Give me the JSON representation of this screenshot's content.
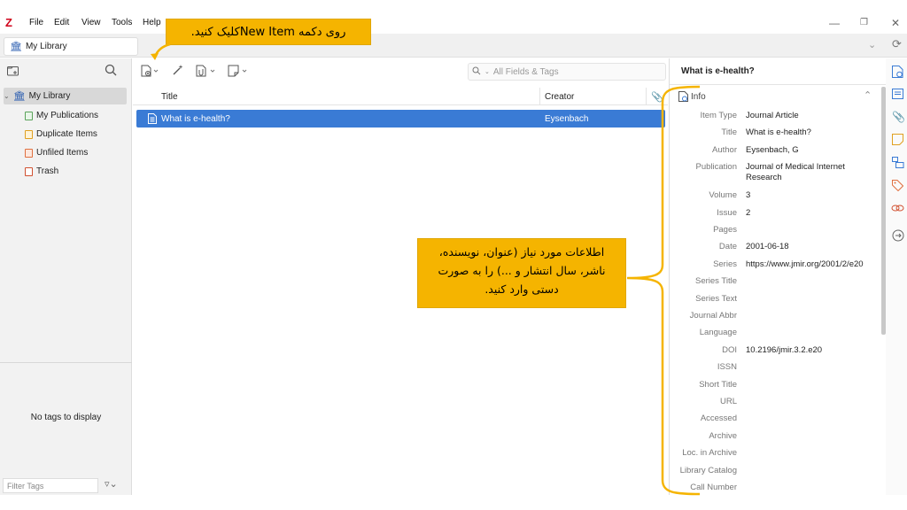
{
  "menu": {
    "logo": "Z",
    "items": [
      "File",
      "Edit",
      "View",
      "Tools",
      "Help"
    ]
  },
  "tab": {
    "label": "My Library"
  },
  "collections": {
    "root": "My Library",
    "children": [
      {
        "label": "My Publications",
        "icon": "my-publications-icon"
      },
      {
        "label": "Duplicate Items",
        "icon": "duplicate-items-icon"
      },
      {
        "label": "Unfiled Items",
        "icon": "unfiled-items-icon"
      },
      {
        "label": "Trash",
        "icon": "trash-icon"
      }
    ]
  },
  "tags": {
    "empty_text": "No tags to display",
    "filter_placeholder": "Filter Tags"
  },
  "search": {
    "placeholder": "All Fields & Tags"
  },
  "columns": {
    "title": "Title",
    "creator": "Creator"
  },
  "items": [
    {
      "title": "What is e-health?",
      "creator": "Eysenbach",
      "selected": true
    }
  ],
  "item_pane": {
    "title": "What is e-health?",
    "section": "Info",
    "fields": [
      {
        "label": "Item Type",
        "value": "Journal Article"
      },
      {
        "label": "Title",
        "value": "What is e-health?"
      },
      {
        "label": "Author",
        "value": "Eysenbach, G"
      },
      {
        "label": "Publication",
        "value": "Journal of Medical Internet Research"
      },
      {
        "label": "Volume",
        "value": "3"
      },
      {
        "label": "Issue",
        "value": "2"
      },
      {
        "label": "Pages",
        "value": ""
      },
      {
        "label": "Date",
        "value": "2001-06-18"
      },
      {
        "label": "Series",
        "value": "https://www.jmir.org/2001/2/e20"
      },
      {
        "label": "Series Title",
        "value": ""
      },
      {
        "label": "Series Text",
        "value": ""
      },
      {
        "label": "Journal Abbr",
        "value": ""
      },
      {
        "label": "Language",
        "value": ""
      },
      {
        "label": "DOI",
        "value": "10.2196/jmir.3.2.e20"
      },
      {
        "label": "ISSN",
        "value": ""
      },
      {
        "label": "Short Title",
        "value": ""
      },
      {
        "label": "URL",
        "value": ""
      },
      {
        "label": "Accessed",
        "value": ""
      },
      {
        "label": "Archive",
        "value": ""
      },
      {
        "label": "Loc. in Archive",
        "value": ""
      },
      {
        "label": "Library Catalog",
        "value": ""
      },
      {
        "label": "Call Number",
        "value": ""
      }
    ]
  },
  "annotations": {
    "top": "روی دکمه New Itemکلیک کنید.",
    "middle_lines": [
      "اطلاعات مورد نیاز (عنوان، نویسنده،",
      "ناشر، سال انتشار و ...) را به صورت",
      "دستی وارد کنید."
    ]
  },
  "colors": {
    "accent": "#3a7bd5",
    "callout": "#f5b400",
    "logo": "#d0021b"
  }
}
